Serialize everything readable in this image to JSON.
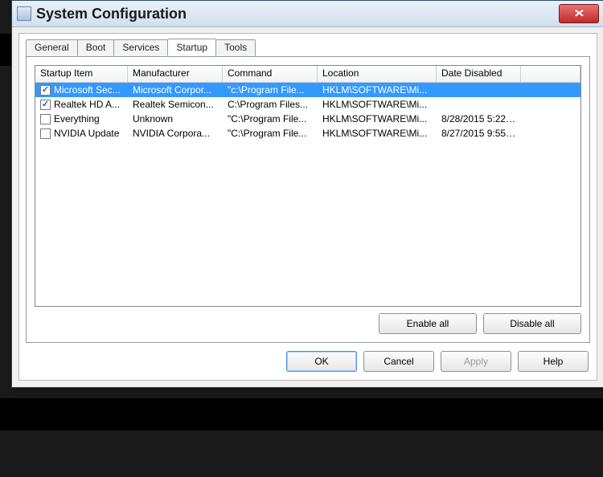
{
  "title": "System Configuration",
  "tabs": [
    "General",
    "Boot",
    "Services",
    "Startup",
    "Tools"
  ],
  "activeTab": 3,
  "columns": [
    "Startup Item",
    "Manufacturer",
    "Command",
    "Location",
    "Date Disabled"
  ],
  "rows": [
    {
      "checked": true,
      "selected": true,
      "item": "Microsoft Sec...",
      "mfr": "Microsoft Corpor...",
      "cmd": "\"c:\\Program File...",
      "loc": "HKLM\\SOFTWARE\\Mi...",
      "date": ""
    },
    {
      "checked": true,
      "selected": false,
      "item": "Realtek HD A...",
      "mfr": "Realtek Semicon...",
      "cmd": "C:\\Program Files...",
      "loc": "HKLM\\SOFTWARE\\Mi...",
      "date": ""
    },
    {
      "checked": false,
      "selected": false,
      "item": "Everything",
      "mfr": "Unknown",
      "cmd": "\"C:\\Program File...",
      "loc": "HKLM\\SOFTWARE\\Mi...",
      "date": "8/28/2015 5:22:..."
    },
    {
      "checked": false,
      "selected": false,
      "item": "NVIDIA Update",
      "mfr": "NVIDIA Corpora...",
      "cmd": "\"C:\\Program File...",
      "loc": "HKLM\\SOFTWARE\\Mi...",
      "date": "8/27/2015 9:55:..."
    }
  ],
  "buttons": {
    "enableAll": "Enable all",
    "disableAll": "Disable all",
    "ok": "OK",
    "cancel": "Cancel",
    "apply": "Apply",
    "help": "Help"
  }
}
